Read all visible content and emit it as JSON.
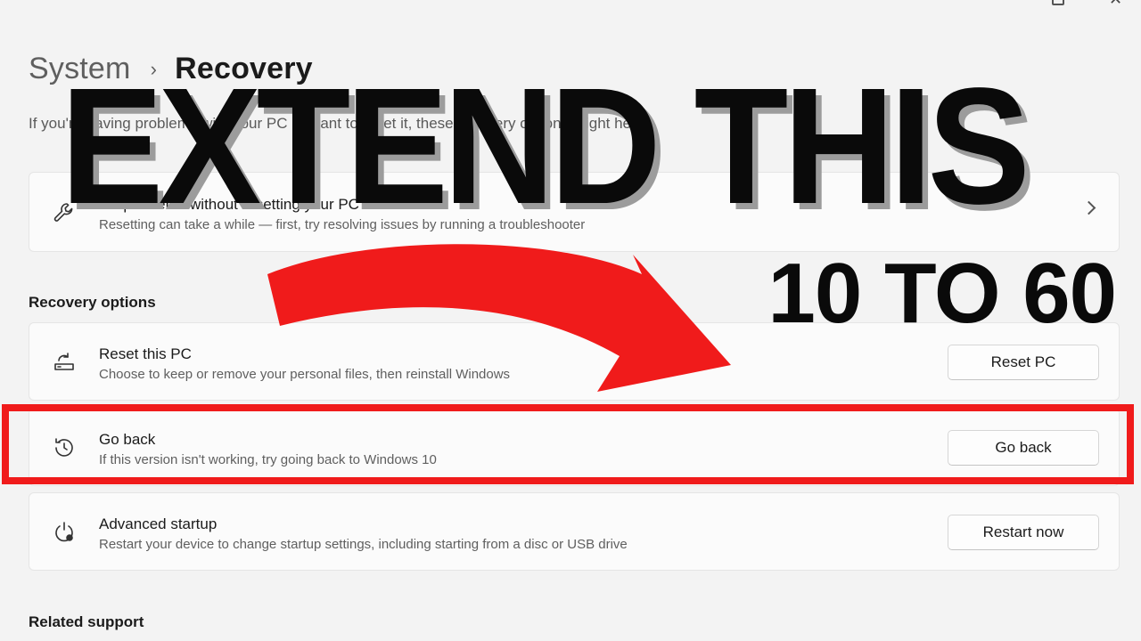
{
  "window": {
    "close_glyph": "✕"
  },
  "breadcrumb": {
    "parent": "System",
    "separator": "›",
    "current": "Recovery"
  },
  "description": "If you're having problems with your PC or want to reset it, these recovery options might help.",
  "fix_card": {
    "title": "Fix problems without resetting your PC",
    "subtitle": "Resetting can take a while — first, try resolving issues by running a troubleshooter",
    "icon": "wrench-icon"
  },
  "recovery_options": {
    "heading": "Recovery options",
    "items": [
      {
        "title": "Reset this PC",
        "subtitle": "Choose to keep or remove your personal files, then reinstall Windows",
        "button": "Reset PC",
        "icon": "reset-pc-icon"
      },
      {
        "title": "Go back",
        "subtitle": "If this version isn't working, try going back to Windows 10",
        "button": "Go back",
        "icon": "history-icon"
      },
      {
        "title": "Advanced startup",
        "subtitle": "Restart your device to change startup settings, including starting from a disc or USB drive",
        "button": "Restart now",
        "icon": "advanced-startup-icon"
      }
    ]
  },
  "related_support": {
    "heading": "Related support"
  },
  "overlay": {
    "headline": "EXTEND THIS",
    "subline": "10 TO 60",
    "accent_color": "#f01b1b"
  }
}
